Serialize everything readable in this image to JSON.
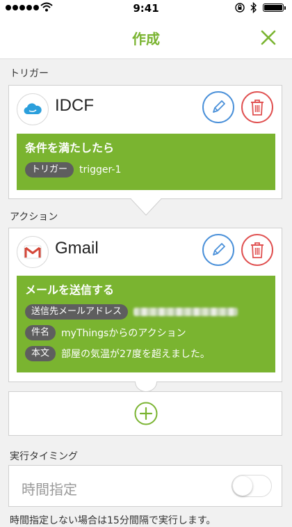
{
  "status_bar": {
    "time": "9:41"
  },
  "nav": {
    "title": "作成",
    "close_icon": "close-icon"
  },
  "trigger_section": {
    "label": "トリガー",
    "service_name": "IDCF",
    "icon": "cloud-icon",
    "condition_title": "条件を満たしたら",
    "params": [
      {
        "tag": "トリガー",
        "value": "trigger-1"
      }
    ]
  },
  "action_section": {
    "label": "アクション",
    "service_name": "Gmail",
    "icon": "gmail-icon",
    "action_title": "メールを送信する",
    "params": [
      {
        "tag": "送信先メールアドレス",
        "value": ""
      },
      {
        "tag": "件名",
        "value": "myThingsからのアクション"
      },
      {
        "tag": "本文",
        "value": "部屋の気温が27度を超えました。"
      }
    ]
  },
  "timing": {
    "label": "実行タイミング",
    "field_label": "時間指定",
    "toggle_on": false,
    "note": "時間指定しない場合は15分間隔で実行します。"
  },
  "colors": {
    "accent": "#7ab431",
    "edit": "#4a90d9",
    "delete": "#e05050",
    "tag_bg": "#5e5e5e"
  }
}
